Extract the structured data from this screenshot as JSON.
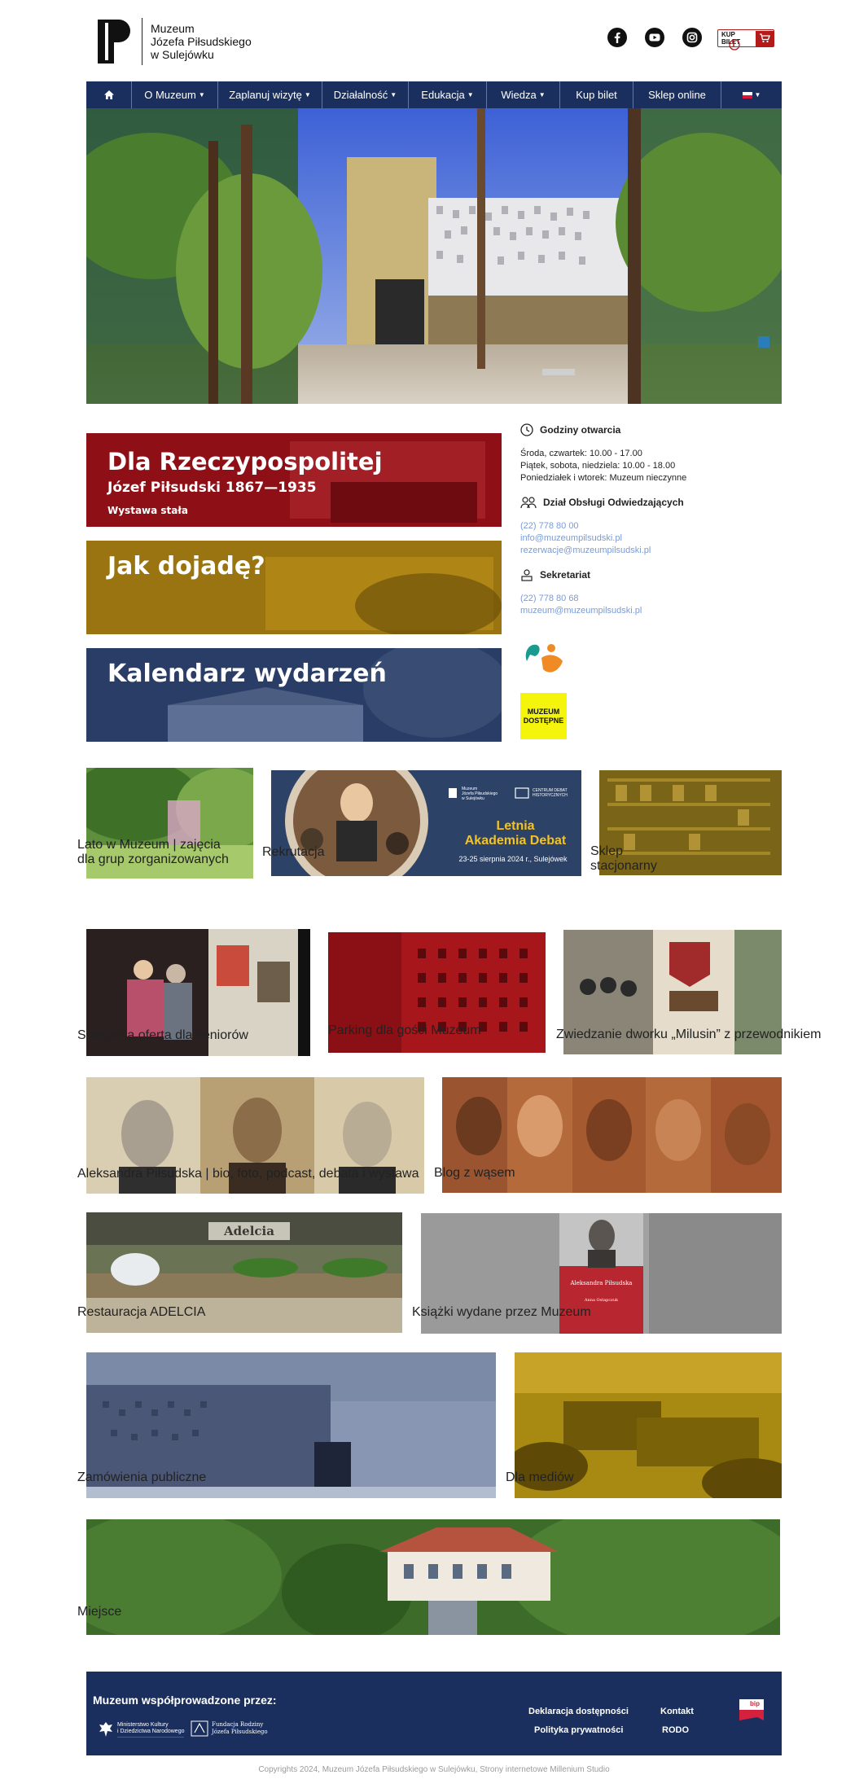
{
  "header": {
    "logo_lines": [
      "Muzeum",
      "Józefa Piłsudskiego",
      "w Sulejówku"
    ],
    "social_icons": [
      "facebook-icon",
      "youtube-icon",
      "instagram-icon"
    ],
    "buy_ticket_label": "KUP BILET"
  },
  "nav": {
    "items": [
      {
        "label": "",
        "icon": "home-icon"
      },
      {
        "label": "O Muzeum",
        "dropdown": true
      },
      {
        "label": "Zaplanuj wizytę",
        "dropdown": true
      },
      {
        "label": "Działalność",
        "dropdown": true
      },
      {
        "label": "Edukacja",
        "dropdown": true
      },
      {
        "label": "Wiedza",
        "dropdown": true
      },
      {
        "label": "Kup bilet",
        "dropdown": false
      },
      {
        "label": "Sklep online",
        "dropdown": false
      },
      {
        "label": "",
        "icon": "polish-flag-icon",
        "dropdown": true
      }
    ]
  },
  "banners": {
    "exhibition": {
      "title": "Dla Rzeczypospolitej",
      "subtitle": "Józef Piłsudski 1867—1935",
      "note": "Wystawa stała"
    },
    "directions": {
      "title": "Jak dojadę?"
    },
    "calendar": {
      "title": "Kalendarz wydarzeń"
    }
  },
  "info": {
    "hours_title": "Godziny otwarcia",
    "hours": [
      "Środa, czwartek: 10.00 - 17.00",
      "Piątek, sobota, niedziela: 10.00 - 18.00",
      "Poniedziałek i wtorek: Muzeum nieczynne"
    ],
    "visitors_title": "Dział Obsługi Odwiedzających",
    "visitors_links": [
      "(22) 778 80 00",
      "info@muzeumpilsudski.pl",
      "rezerwacje@muzeumpilsudski.pl"
    ],
    "secretariat_title": "Sekretariat",
    "secretariat_links": [
      "(22) 778 80 68",
      "muzeum@muzeumpilsudski.pl"
    ],
    "accessible_badge": [
      "MUZEUM",
      "DOSTĘPNE"
    ]
  },
  "promo": {
    "lines_top": [
      "Muzeum",
      "Józefa Piłsudskiego",
      "w Sulejówku"
    ],
    "partner": [
      "CENTRUM DEBAT",
      "HISTORYCZNYCH"
    ],
    "title_line1": "Letnia",
    "title_line2": "Akademia Debat",
    "date": "23-25 sierpnia 2024 r., Sulejówek"
  },
  "book_cover": {
    "title": "Aleksandra Piłsudska",
    "author": "Anna Ostapczuk"
  },
  "restaurant_sign": "Adelcia",
  "tiles": [
    {
      "caption": "Lato w Muzeum | zajęcia dla grup zorganizowanych"
    },
    {
      "caption": "Rekrutacja"
    },
    {
      "caption": "Sklep stacjonarny"
    },
    {
      "caption": "Specjalna oferta dla seniorów"
    },
    {
      "caption": "Parking dla gości Muzeum"
    },
    {
      "caption": "Zwiedzanie dworku „Milusin” z przewodnikiem"
    },
    {
      "caption": "Aleksandra Piłsudska | bio, foto, podcast, debata i wystawa"
    },
    {
      "caption": "Blog z wąsem"
    },
    {
      "caption": "Restauracja ADELCIA"
    },
    {
      "caption": "Książki wydane przez Muzeum"
    },
    {
      "caption": "Zamówienia publiczne"
    },
    {
      "caption": "Dla mediów"
    },
    {
      "caption": "Miejsce"
    }
  ],
  "footer": {
    "title": "Muzeum współprowadzone przez:",
    "partner1": [
      "Ministerstwo Kultury",
      "i Dziedzictwa Narodowego"
    ],
    "partner2": [
      "Fundacja Rodziny",
      "Józefa Piłsudskiego"
    ],
    "links": [
      "Deklaracja dostępności",
      "Kontakt",
      "Polityka prywatności",
      "RODO"
    ],
    "bip": "bip"
  },
  "copyright": "Copyrights 2024, Muzeum Józefa Piłsudskiego w Sulejówku, Strony internetowe Millenium Studio",
  "colors": {
    "navy": "#1a2f5e",
    "accent_red": "#b31b1b",
    "link": "#7a9bd6",
    "caption_bg": "#3c4862"
  }
}
